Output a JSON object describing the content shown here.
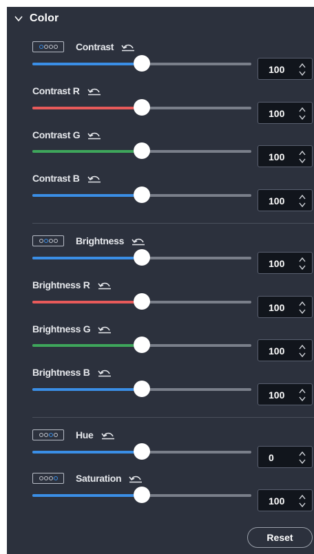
{
  "section": {
    "title": "Color",
    "expanded": true
  },
  "colors": {
    "panel_bg": "#2c313d",
    "blue": "#3a8ee6",
    "red": "#e85a5a",
    "green": "#3ea65b",
    "track": "#7a7f8a"
  },
  "controls": [
    {
      "id": "contrast",
      "label": "Contrast",
      "has_chip": true,
      "chip_active": 0,
      "color": "blue",
      "value": "100",
      "level": 0.5
    },
    {
      "id": "contrast-r",
      "label": "Contrast R",
      "has_chip": false,
      "color": "red",
      "value": "100",
      "level": 0.5
    },
    {
      "id": "contrast-g",
      "label": "Contrast G",
      "has_chip": false,
      "color": "green",
      "value": "100",
      "level": 0.5
    },
    {
      "id": "contrast-b",
      "label": "Contrast B",
      "has_chip": false,
      "color": "blue",
      "value": "100",
      "level": 0.5
    },
    {
      "id": "brightness",
      "label": "Brightness",
      "has_chip": true,
      "chip_active": 1,
      "color": "blue",
      "value": "100",
      "level": 0.5
    },
    {
      "id": "brightness-r",
      "label": "Brightness R",
      "has_chip": false,
      "color": "red",
      "value": "100",
      "level": 0.5
    },
    {
      "id": "brightness-g",
      "label": "Brightness G",
      "has_chip": false,
      "color": "green",
      "value": "100",
      "level": 0.5
    },
    {
      "id": "brightness-b",
      "label": "Brightness B",
      "has_chip": false,
      "color": "blue",
      "value": "100",
      "level": 0.5
    },
    {
      "id": "hue",
      "label": "Hue",
      "has_chip": true,
      "chip_active": 2,
      "color": "blue",
      "value": "0",
      "level": 0.5
    },
    {
      "id": "saturation",
      "label": "Saturation",
      "has_chip": true,
      "chip_active": 3,
      "color": "blue",
      "value": "100",
      "level": 0.5
    }
  ],
  "icons": {
    "collapse": "chevron-down-icon",
    "undo": "undo-icon",
    "spinner": "spinner-arrows-icon",
    "chip": "color-channel-chip-icon"
  },
  "actions": {
    "reset_label": "Reset"
  }
}
